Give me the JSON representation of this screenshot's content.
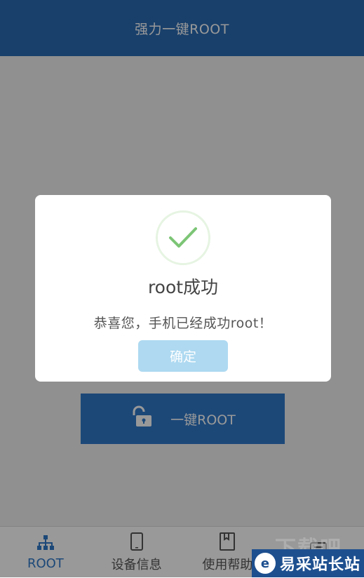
{
  "app": {
    "title": "强力一键ROOT"
  },
  "main": {
    "root_button_label": "一键ROOT"
  },
  "tabs": [
    {
      "label": "ROOT",
      "icon": "network-icon",
      "active": true
    },
    {
      "label": "设备信息",
      "icon": "phone-icon",
      "active": false
    },
    {
      "label": "使用帮助",
      "icon": "book-icon",
      "active": false
    },
    {
      "label": "",
      "icon": "more-icon",
      "active": false
    }
  ],
  "dialog": {
    "title": "root成功",
    "message": "恭喜您，手机已经成功root！",
    "confirm_label": "确定",
    "icon": "checkmark-icon"
  },
  "watermark": {
    "logo_letter": "e",
    "text": "易采站长站",
    "faint_text": "下载吧"
  },
  "colors": {
    "title_bar": "#2a6bb3",
    "root_button": "#2f79c8",
    "confirm_button": "#aed9f1",
    "check": "#7cc576"
  }
}
